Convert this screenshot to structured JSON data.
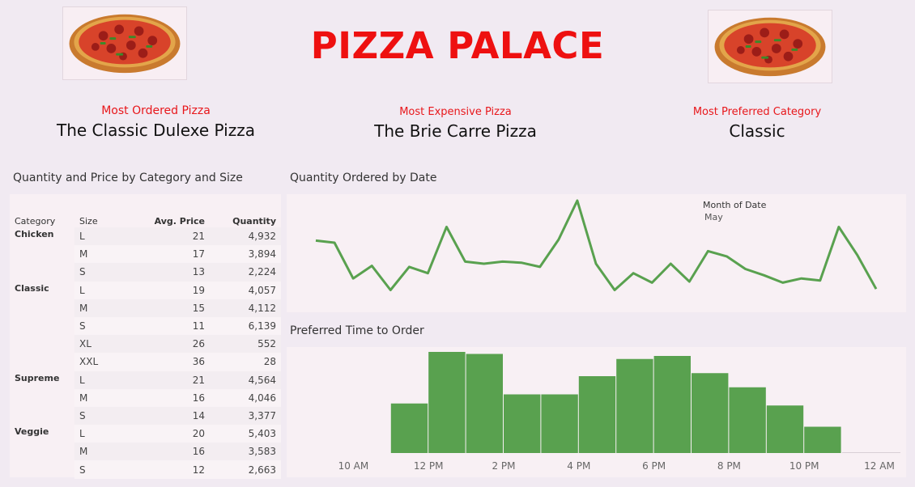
{
  "header": {
    "title": "PIZZA PALACE",
    "logo_left": "pizza-image",
    "logo_right": "pizza-image"
  },
  "kpis": [
    {
      "label": "Most Ordered Pizza",
      "value": "The Classic Dulexe Pizza"
    },
    {
      "label": "Most Expensive Pizza",
      "value": "The Brie Carre Pizza"
    },
    {
      "label": "Most Preferred Category",
      "value": "Classic"
    }
  ],
  "table": {
    "title": "Quantity and Price by Category and Size",
    "headers": {
      "category": "Category",
      "size": "Size",
      "price": "Avg. Price",
      "qty": "Quantity"
    },
    "rows": [
      {
        "category": "Chicken",
        "size": "L",
        "price": "21",
        "qty": "4,932"
      },
      {
        "category": "",
        "size": "M",
        "price": "17",
        "qty": "3,894"
      },
      {
        "category": "",
        "size": "S",
        "price": "13",
        "qty": "2,224"
      },
      {
        "category": "Classic",
        "size": "L",
        "price": "19",
        "qty": "4,057"
      },
      {
        "category": "",
        "size": "M",
        "price": "15",
        "qty": "4,112"
      },
      {
        "category": "",
        "size": "S",
        "price": "11",
        "qty": "6,139"
      },
      {
        "category": "",
        "size": "XL",
        "price": "26",
        "qty": "552"
      },
      {
        "category": "",
        "size": "XXL",
        "price": "36",
        "qty": "28"
      },
      {
        "category": "Supreme",
        "size": "L",
        "price": "21",
        "qty": "4,564"
      },
      {
        "category": "",
        "size": "M",
        "price": "16",
        "qty": "4,046"
      },
      {
        "category": "",
        "size": "S",
        "price": "14",
        "qty": "3,377"
      },
      {
        "category": "Veggie",
        "size": "L",
        "price": "20",
        "qty": "5,403"
      },
      {
        "category": "",
        "size": "M",
        "price": "16",
        "qty": "3,583"
      },
      {
        "category": "",
        "size": "S",
        "price": "12",
        "qty": "2,663"
      }
    ]
  },
  "line_chart": {
    "title": "Quantity Ordered by Date",
    "tooltip_label": "Month of Date",
    "tooltip_value": "May",
    "color": "#59a14f"
  },
  "bar_chart": {
    "title": "Preferred Time to Order",
    "color": "#59a14f"
  },
  "chart_data": [
    {
      "type": "line",
      "title": "Quantity Ordered by Date",
      "x": [
        "1",
        "2",
        "3",
        "4",
        "5",
        "6",
        "7",
        "8",
        "9",
        "10",
        "11",
        "12",
        "13",
        "14",
        "15",
        "16",
        "17",
        "18",
        "19",
        "20",
        "21",
        "22",
        "23",
        "24",
        "25",
        "26",
        "27",
        "28",
        "29",
        "30",
        "31"
      ],
      "values": [
        0.62,
        0.6,
        0.26,
        0.38,
        0.15,
        0.37,
        0.31,
        0.75,
        0.42,
        0.4,
        0.42,
        0.41,
        0.37,
        0.63,
        1.0,
        0.4,
        0.15,
        0.31,
        0.22,
        0.4,
        0.23,
        0.52,
        0.47,
        0.35,
        0.29,
        0.22,
        0.26,
        0.24,
        0.75,
        0.48,
        0.16
      ],
      "ylim": [
        0,
        1
      ],
      "grid": false
    },
    {
      "type": "bar",
      "title": "Preferred Time to Order",
      "categories": [
        "9 AM",
        "10 AM",
        "11 AM",
        "12 PM",
        "1 PM",
        "2 PM",
        "3 PM",
        "4 PM",
        "5 PM",
        "6 PM",
        "7 PM",
        "8 PM",
        "9 PM",
        "10 PM",
        "11 PM"
      ],
      "tick_labels": [
        "10 AM",
        "12 PM",
        "2 PM",
        "4 PM",
        "6 PM",
        "8 PM",
        "10 PM",
        "12 AM"
      ],
      "values": [
        0,
        0,
        49,
        100,
        98,
        58,
        58,
        76,
        93,
        96,
        79,
        65,
        47,
        26,
        0
      ],
      "ylim": [
        0,
        100
      ],
      "grid": false
    }
  ]
}
